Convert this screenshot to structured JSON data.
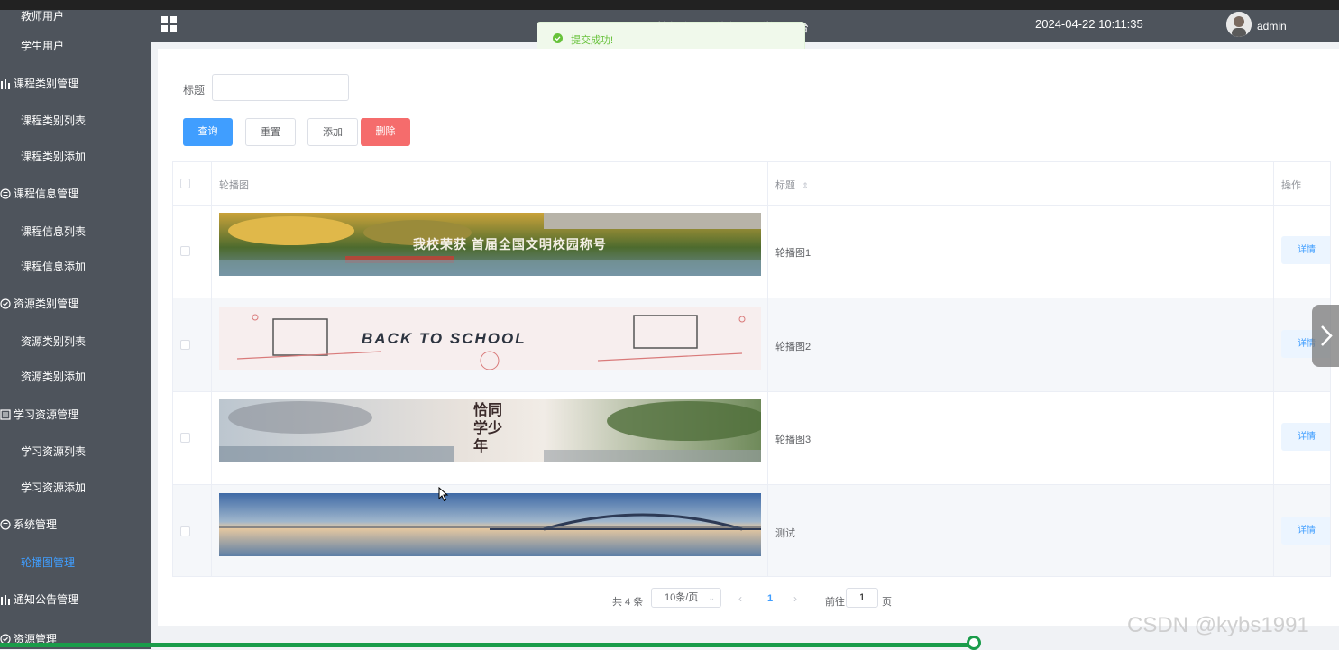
{
  "sidebar": {
    "items": [
      {
        "label": "教师用户",
        "type": "child"
      },
      {
        "label": "学生用户",
        "type": "child"
      },
      {
        "label": "课程类别管理",
        "type": "group",
        "icon": "bar-chart-icon"
      },
      {
        "label": "课程类别列表",
        "type": "child"
      },
      {
        "label": "课程类别添加",
        "type": "child"
      },
      {
        "label": "课程信息管理",
        "type": "group",
        "icon": "menu-circle-icon"
      },
      {
        "label": "课程信息列表",
        "type": "child"
      },
      {
        "label": "课程信息添加",
        "type": "child"
      },
      {
        "label": "资源类别管理",
        "type": "group",
        "icon": "check-circle-icon"
      },
      {
        "label": "资源类别列表",
        "type": "child"
      },
      {
        "label": "资源类别添加",
        "type": "child"
      },
      {
        "label": "学习资源管理",
        "type": "group",
        "icon": "list-icon"
      },
      {
        "label": "学习资源列表",
        "type": "child"
      },
      {
        "label": "学习资源添加",
        "type": "child"
      },
      {
        "label": "系统管理",
        "type": "group",
        "icon": "menu-circle-icon"
      },
      {
        "label": "轮播图管理",
        "type": "child",
        "active": true
      },
      {
        "label": "通知公告管理",
        "type": "group",
        "icon": "bar-chart-icon"
      },
      {
        "label": "资源管理",
        "type": "group",
        "icon": "check-circle-icon"
      }
    ]
  },
  "header": {
    "platform_title": "教师资源一体化课程学习平台",
    "datetime": "2024-04-22 10:11:35",
    "username": "admin"
  },
  "toast": {
    "message": "提交成功!"
  },
  "search": {
    "label": "标题",
    "value": "",
    "placeholder": ""
  },
  "actions": {
    "query": "查询",
    "reset": "重置",
    "add": "添加",
    "delete": "删除"
  },
  "table": {
    "columns": {
      "image": "轮播图",
      "title": "标题",
      "ops": "操作"
    },
    "rows": [
      {
        "title": "轮播图1",
        "detail": "详情",
        "banner_text": "我校荣获 首届全国文明校园称号"
      },
      {
        "title": "轮播图2",
        "detail": "详情",
        "banner_text": "BACK TO SCHOOL"
      },
      {
        "title": "轮播图3",
        "detail": "详情",
        "banner_text": "恰同学少年"
      },
      {
        "title": "测试",
        "detail": "详情",
        "banner_text": ""
      }
    ]
  },
  "pagination": {
    "total": "共 4 条",
    "page_size": "10条/页",
    "current_page": "1",
    "goto_label": "前往",
    "goto_value": "1",
    "goto_unit": "页"
  },
  "video_progress": 0.727,
  "watermark": "CSDN @kybs1991",
  "colors": {
    "primary": "#409eff",
    "danger": "#f56c6c",
    "success": "#67c23a",
    "sidebar": "#4e545c"
  }
}
